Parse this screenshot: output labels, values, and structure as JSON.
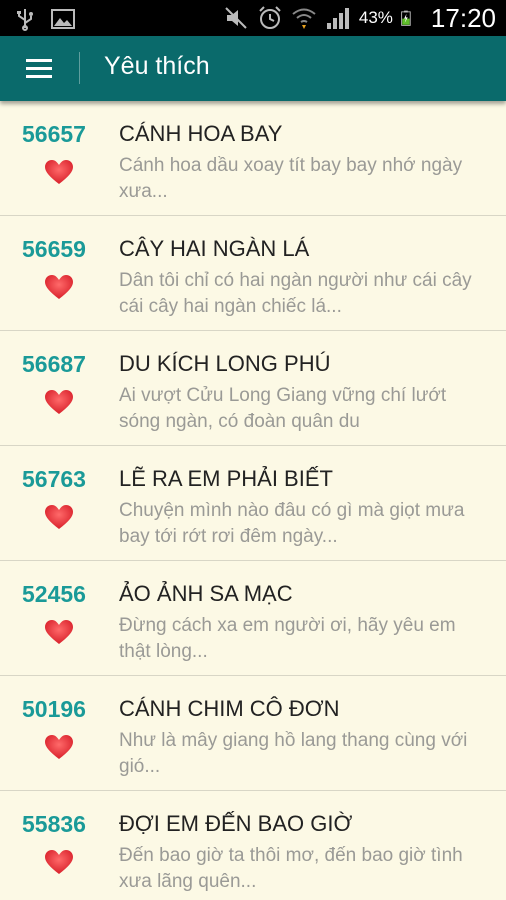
{
  "status_bar": {
    "battery": "43%",
    "time": "17:20",
    "icons": [
      "usb-icon",
      "image-icon",
      "mute-icon",
      "alarm-icon",
      "wifi-icon",
      "signal-icon",
      "battery-icon"
    ]
  },
  "toolbar": {
    "title": "Yêu thích",
    "menu_icon": "hamburger-icon"
  },
  "colors": {
    "toolbar": "#0a6a6b",
    "number": "#1a9a98",
    "heart": "#e8363c",
    "background": "#fcf9e5"
  },
  "songs": [
    {
      "id": "56657",
      "title": "CÁNH HOA BAY",
      "lyric": "Cánh hoa dầu xoay tít bay bay nhớ ngày xưa..."
    },
    {
      "id": "56659",
      "title": "CÂY HAI NGÀN LÁ",
      "lyric": "Dân tôi chỉ có hai ngàn người như cái cây cái cây hai ngàn chiếc lá..."
    },
    {
      "id": "56687",
      "title": "DU KÍCH LONG PHÚ",
      "lyric": "Ai vượt Cửu Long Giang vững chí lướt sóng ngàn, có đoàn quân du"
    },
    {
      "id": "56763",
      "title": "LẼ RA EM PHẢI BIẾT",
      "lyric": "Chuyện mình nào đâu có gì mà giọt mưa bay tới rớt rơi đêm ngày..."
    },
    {
      "id": "52456",
      "title": "ẢO ẢNH SA MẠC",
      "lyric": "Đừng cách xa em người ơi, hãy yêu em thật lòng..."
    },
    {
      "id": "50196",
      "title": "CÁNH CHIM CÔ ĐƠN",
      "lyric": "Như là mây giang hồ lang thang cùng với gió..."
    },
    {
      "id": "55836",
      "title": "ĐỢI EM ĐẾN BAO GIỜ",
      "lyric": "Đến bao giờ ta thôi mơ, đến bao giờ tình xưa lãng quên..."
    }
  ]
}
